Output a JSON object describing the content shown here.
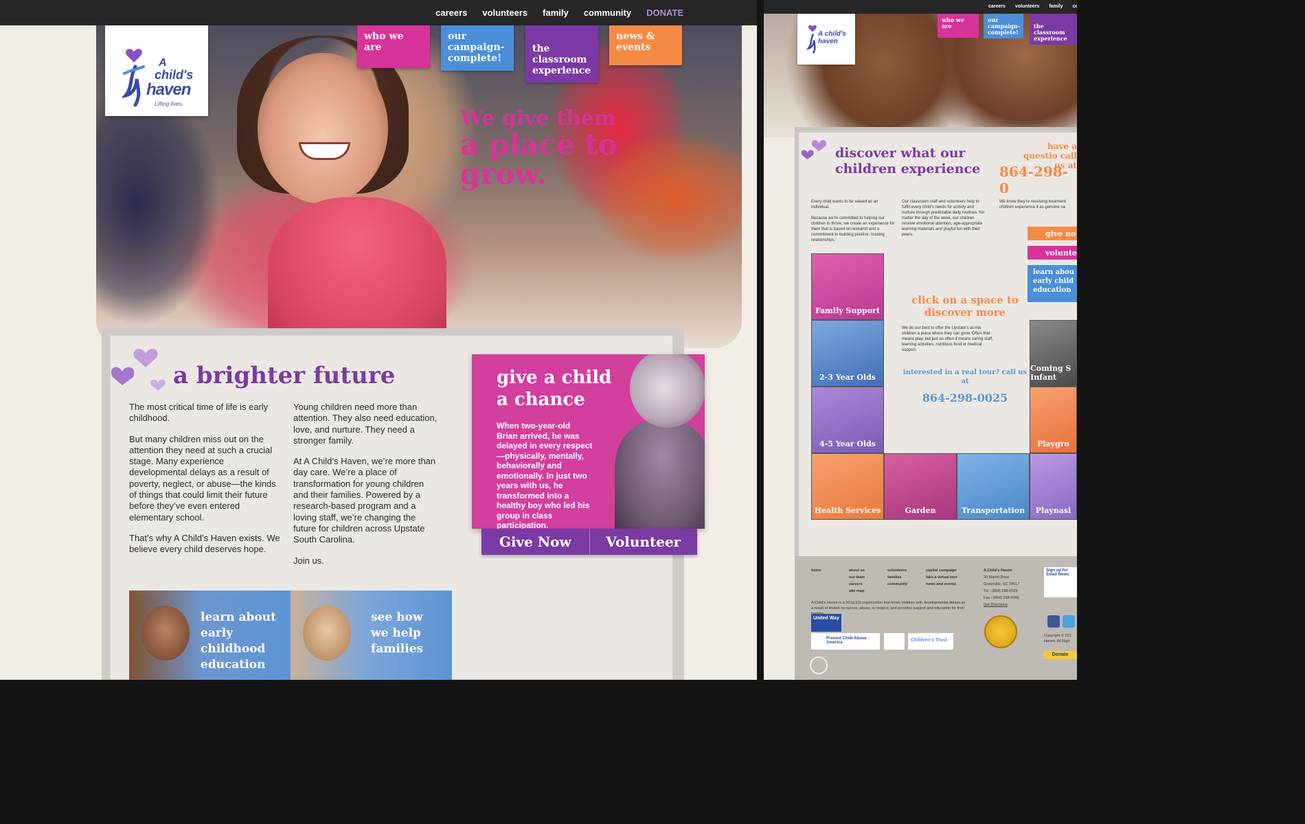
{
  "nav": {
    "careers": "careers",
    "volunteers": "volunteers",
    "family": "family",
    "community": "community",
    "donate": "DONATE"
  },
  "logo": {
    "line1": "A",
    "line2": "child's",
    "line3": "haven",
    "tagline": "Lifting lives."
  },
  "tabs": {
    "who": "who we are",
    "campaign": "our campaign-complete!",
    "classroom": "the classroom experience",
    "news": "news & events"
  },
  "headline": {
    "l1": "We give them",
    "l2": "a place to",
    "l3": "grow."
  },
  "section": {
    "title": "a brighter future",
    "col1": [
      "The most critical time of life is early childhood.",
      "But many children miss out on the attention they need at such a crucial stage. Many experience developmental delays as a result of poverty, neglect, or abuse—the kinds of things that could limit their future before they’ve even entered elementary school.",
      "That’s why A Child’s Haven exists. We believe every child deserves hope."
    ],
    "col2": [
      "Young children need more than attention. They also need education, love, and nurture. They need a stronger family.",
      "At A Child’s Haven, we’re more than day care. We’re a place of transformation for young children and their families. Powered by a research-based program and a loving staff, we’re changing the future for children across Upstate South Carolina.",
      "Join us."
    ]
  },
  "give": {
    "title1": "give a child",
    "title2": "a chance",
    "body": "When two-year-old Brian arrived, he was delayed in every respect—physically, mentally, behaviorally and emotionally. In just two years with us, he transformed into a healthy boy who led his group in class participation.",
    "give_now": "Give Now",
    "volunteer": "Volunteer"
  },
  "promos": [
    {
      "l1": "learn about",
      "l2": "early",
      "l3": "childhood",
      "l4": "education"
    },
    {
      "l1": "see how",
      "l2": "we help",
      "l3": "families"
    }
  ],
  "right": {
    "nav": {
      "careers": "careers",
      "volunteers": "volunteers",
      "family": "family",
      "community": "comm"
    },
    "logo": "A child's haven",
    "tabs": {
      "who": "who we are",
      "campaign": "our campaign-complete!",
      "classroom": "the classroom experience"
    },
    "title": "discover what our children experience",
    "question": "have a questio call us at",
    "phone_top": "864-298-0",
    "p1": "Every child wants to be valued as an individual.",
    "p2": "Because we’re committed to helping our children to thrive, we create an experience for them that is based on research and a commitment to building positive, trusting relationships.",
    "p3": "Our classroom staff and volunteers help to fulfill every child’s needs for activity and nurture through predictable daily routines. No matter the day of the week, our children receive emotional attention, age-appropriate learning materials and playful fun with their peers.",
    "p4": "We know they’re receiving treatment children experience it as genuine ca",
    "btn_give": "give no",
    "btn_vol": "voluntee",
    "btn_learn": "learn abou early child education",
    "click_title": "click on a space to discover more",
    "click_body": "We do our best to offer the Upstate’s at-risk children a place where they can grow. Often that means play, but just as often it means caring staff, learning activities, nutritious food or medical support.",
    "tour": "interested in a real tour? call us at",
    "phone": "864-298-0025",
    "cells": [
      "Family Support",
      "2-3 Year Olds",
      "4-5 Year Olds",
      "Health Services",
      "Garden",
      "Transportation",
      "Playnasi",
      "Coming S Infant",
      "Playgro"
    ],
    "footer": {
      "c1": "home",
      "c2a": "about us",
      "c2b": "our team",
      "c2c": "careers",
      "c2d": "site map",
      "c3a": "volunteers",
      "c3b": "families",
      "c3c": "community",
      "c4a": "capital campaign",
      "c4b": "take a virtual tour",
      "c4c": "news and events",
      "addr1": "A Child’s Haven",
      "addr2": "20 Martin Drive",
      "addr3": "Greenville, SC 29617",
      "tel": "Tel - (864) 298-0025",
      "fax": "Fax - (864) 298-0045",
      "dir": "Get Directions",
      "about": "A Child’s Haven is a 501(c)(3) organization that treats children with developmental delays as a result of limited resources, abuse, or neglect, and provides support and education for their families. .",
      "signup": "Sign up for Email News",
      "copy": "Copyright © 201 Haven. All Righ",
      "donate": "Donate",
      "uw": "United Way",
      "pca": "Prevent Child Abuse America",
      "ct": "Children’s Trust"
    }
  }
}
